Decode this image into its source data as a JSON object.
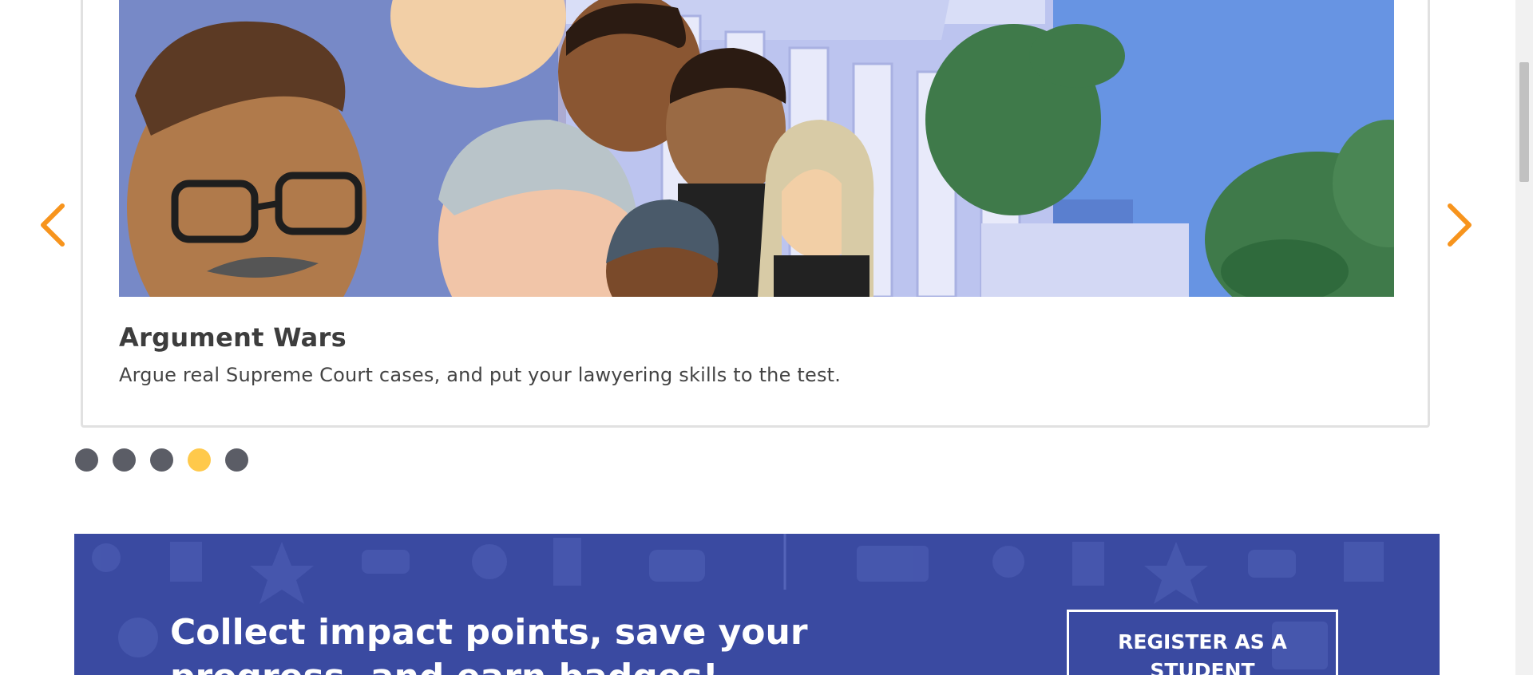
{
  "carousel": {
    "title": "Argument Wars",
    "description": "Argue real Supreme Court cases, and put your lawyering skills to the test.",
    "hero_image": "argument-wars-court-illustration",
    "prev_icon": "chevron-left-icon",
    "next_icon": "chevron-right-icon",
    "dots": [
      {
        "active": false
      },
      {
        "active": false
      },
      {
        "active": false
      },
      {
        "active": true
      },
      {
        "active": false
      }
    ],
    "arrow_color": "#f7941d",
    "dot_color": "#5b5d66",
    "active_dot_color": "#ffc94b"
  },
  "banner": {
    "text": "Collect impact points, save your progress, and earn badges!",
    "register_label": "REGISTER AS A STUDENT",
    "background": "#3a4aa1"
  }
}
